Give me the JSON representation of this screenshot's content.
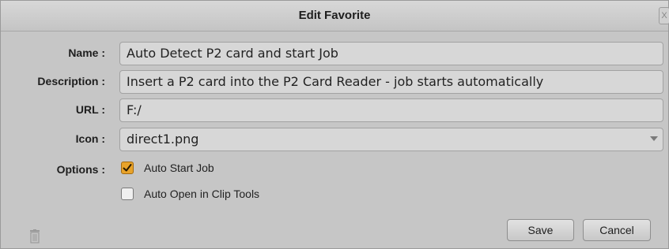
{
  "dialog": {
    "title": "Edit Favorite",
    "close_glyph": "X"
  },
  "fields": {
    "name": {
      "label": "Name :",
      "value": "Auto Detect P2 card and start Job"
    },
    "description": {
      "label": "Description :",
      "value": "Insert a P2 card into the P2 Card Reader - job starts automatically"
    },
    "url": {
      "label": "URL :",
      "value": "F:/"
    },
    "icon": {
      "label": "Icon :",
      "value": "direct1.png"
    }
  },
  "options": {
    "label": "Options :",
    "auto_start_job": {
      "label": "Auto Start Job",
      "checked": true
    },
    "auto_open_clip_tools": {
      "label": "Auto Open in Clip Tools",
      "checked": false
    }
  },
  "buttons": {
    "save": "Save",
    "cancel": "Cancel"
  },
  "icons": {
    "delete": "trash-icon",
    "close": "close-icon",
    "dropdown": "chevron-down-icon",
    "check": "checkmark-icon"
  },
  "colors": {
    "checkbox_checked": "#e8a32a",
    "background": "#c6c6c6",
    "field": "#d7d7d7"
  }
}
